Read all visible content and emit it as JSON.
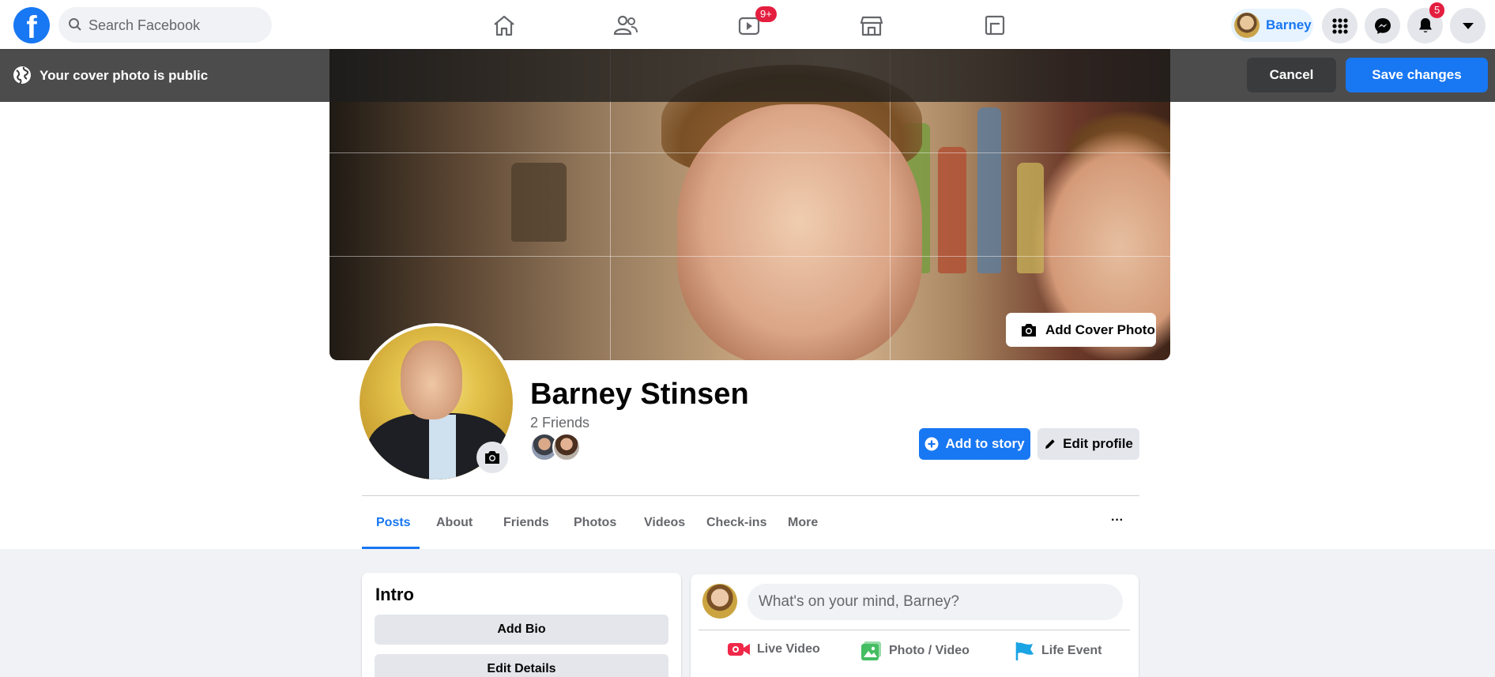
{
  "topnav": {
    "logo_letter": "f",
    "search_placeholder": "Search Facebook",
    "watch_badge": "9+",
    "profile_name": "Barney",
    "notifications_badge": "5"
  },
  "editbar": {
    "message": "Your cover photo is public",
    "cancel_label": "Cancel",
    "save_label": "Save changes"
  },
  "cover": {
    "add_cover_label": "Add Cover Photo"
  },
  "profile": {
    "name": "Barney Stinsen",
    "friends_count": "2 Friends",
    "add_story_label": "Add to story",
    "edit_profile_label": "Edit profile"
  },
  "tabs": [
    {
      "label": "Posts",
      "active": true
    },
    {
      "label": "About"
    },
    {
      "label": "Friends"
    },
    {
      "label": "Photos"
    },
    {
      "label": "Videos"
    },
    {
      "label": "Check-ins"
    },
    {
      "label": "More"
    }
  ],
  "tabs_more_icon": "···",
  "intro": {
    "title": "Intro",
    "add_bio": "Add Bio",
    "edit_details": "Edit Details"
  },
  "composer": {
    "placeholder": "What's on your mind, Barney?",
    "live_video": "Live Video",
    "photo_video": "Photo / Video",
    "life_event": "Life Event"
  },
  "colors": {
    "accent": "#1877f2",
    "badge": "#e41e3f",
    "live_video_icon": "#f02849",
    "photo_icon": "#45bd62",
    "life_event_icon": "#1ba4e4"
  }
}
